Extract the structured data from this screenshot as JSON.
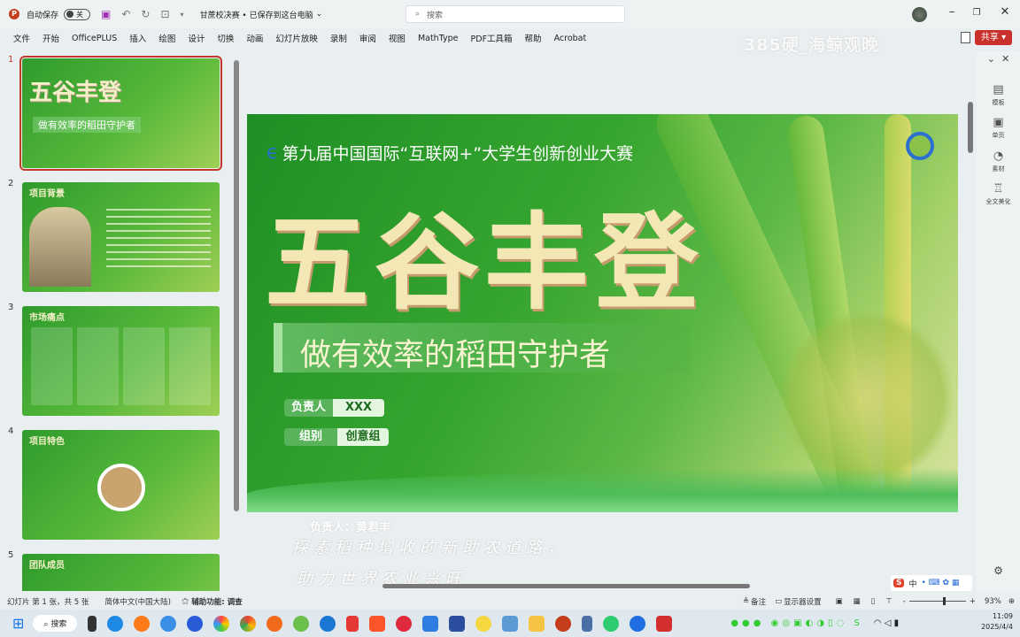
{
  "titlebar": {
    "autosave_label": "自动保存",
    "autosave_state": "关",
    "document_title": "甘蔗校决赛 • 已保存到这台电脑",
    "search_placeholder": "搜索",
    "share_label": "共享"
  },
  "menu": [
    "文件",
    "开始",
    "OfficePLUS",
    "插入",
    "绘图",
    "设计",
    "切换",
    "动画",
    "幻灯片放映",
    "录制",
    "审阅",
    "视图",
    "MathType",
    "PDF工具箱",
    "帮助",
    "Acrobat"
  ],
  "watermark": "385硬_海鲸观晚",
  "thumbnails": [
    {
      "num": "1",
      "title": "五谷丰登"
    },
    {
      "num": "2",
      "title": "项目背景"
    },
    {
      "num": "3",
      "title": "市场痛点"
    },
    {
      "num": "4",
      "title": "项目特色"
    },
    {
      "num": "5",
      "title": "团队成员"
    }
  ],
  "slide": {
    "competition": "第九届中国国际“互联网+”大学生创新创业大赛",
    "title": "五谷丰登",
    "subtitle": "做有效率的稻田守护者",
    "fields": [
      {
        "key": "负责人",
        "value": "XXX"
      },
      {
        "key": "组别",
        "value": "创意组"
      }
    ]
  },
  "overlay": {
    "leader": "负责人：黄君丰",
    "hand_line1": "探索稻种增收的新助农道路，",
    "hand_line2": "助力世界农业兴旺"
  },
  "right_panel": [
    "模板",
    "单页",
    "素材",
    "全文美化"
  ],
  "status": {
    "slide_info": "幻灯片 第 1 张，共 5 张",
    "language": "简体中文(中国大陆)",
    "accessibility": "辅助功能: 调查",
    "notes": "备注",
    "display_settings": "显示器设置",
    "zoom": "93%"
  },
  "taskbar": {
    "search_label": "搜索",
    "time": "11:09",
    "date": "2025/4/4",
    "ime": "中"
  }
}
